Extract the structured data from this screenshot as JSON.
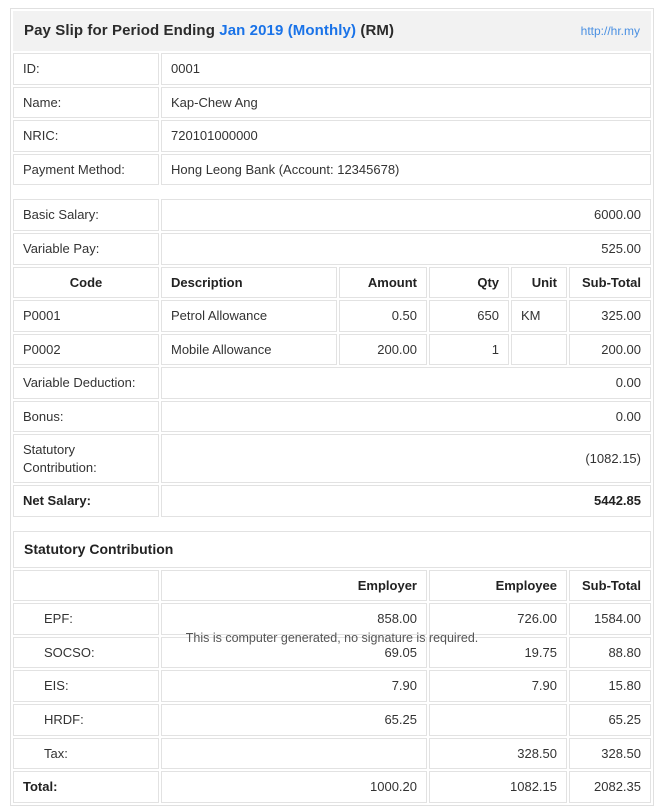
{
  "header": {
    "title_prefix": "Pay Slip for Period Ending",
    "period": "Jan 2019 (Monthly)",
    "currency": "(RM)",
    "link": "http://hr.my"
  },
  "employee": {
    "rows": [
      {
        "label": "ID:",
        "value": "0001"
      },
      {
        "label": "Name:",
        "value": "Kap-Chew Ang"
      },
      {
        "label": "NRIC:",
        "value": "720101000000"
      },
      {
        "label": "Payment Method:",
        "value": "Hong Leong Bank (Account: 12345678)"
      }
    ]
  },
  "earnings": {
    "basic_salary_label": "Basic Salary:",
    "basic_salary_value": "6000.00",
    "variable_pay_label": "Variable Pay:",
    "variable_pay_value": "525.00"
  },
  "allowance_table": {
    "headers": {
      "code": "Code",
      "description": "Description",
      "amount": "Amount",
      "qty": "Qty",
      "unit": "Unit",
      "subtotal": "Sub-Total"
    },
    "rows": [
      {
        "code": "P0001",
        "description": "Petrol Allowance",
        "amount": "0.50",
        "qty": "650",
        "unit": "KM",
        "subtotal": "325.00"
      },
      {
        "code": "P0002",
        "description": "Mobile Allowance",
        "amount": "200.00",
        "qty": "1",
        "unit": "",
        "subtotal": "200.00"
      }
    ]
  },
  "summary": {
    "variable_deduction_label": "Variable Deduction:",
    "variable_deduction_value": "0.00",
    "bonus_label": "Bonus:",
    "bonus_value": "0.00",
    "statutory_contribution_label": "Statutory Contribution:",
    "statutory_contribution_value": "(1082.15)",
    "net_salary_label": "Net Salary:",
    "net_salary_value": "5442.85"
  },
  "statutory": {
    "section_title": "Statutory Contribution",
    "headers": {
      "blank": "",
      "employer": "Employer",
      "employee": "Employee",
      "subtotal": "Sub-Total"
    },
    "rows": [
      {
        "label": "EPF:",
        "employer": "858.00",
        "employee": "726.00",
        "subtotal": "1584.00"
      },
      {
        "label": "SOCSO:",
        "employer": "69.05",
        "employee": "19.75",
        "subtotal": "88.80"
      },
      {
        "label": "EIS:",
        "employer": "7.90",
        "employee": "7.90",
        "subtotal": "15.80"
      },
      {
        "label": "HRDF:",
        "employer": "65.25",
        "employee": "",
        "subtotal": "65.25"
      },
      {
        "label": "Tax:",
        "employer": "",
        "employee": "328.50",
        "subtotal": "328.50"
      }
    ],
    "total": {
      "label": "Total:",
      "employer": "1000.20",
      "employee": "1082.15",
      "subtotal": "2082.35"
    }
  },
  "footer": {
    "note": "This is computer generated, no signature is required."
  },
  "colors": {
    "accent_blue": "#1a73e8",
    "link_blue": "#4a90e2",
    "header_bg": "#f2f2f2",
    "border": "#e2e2e2"
  }
}
